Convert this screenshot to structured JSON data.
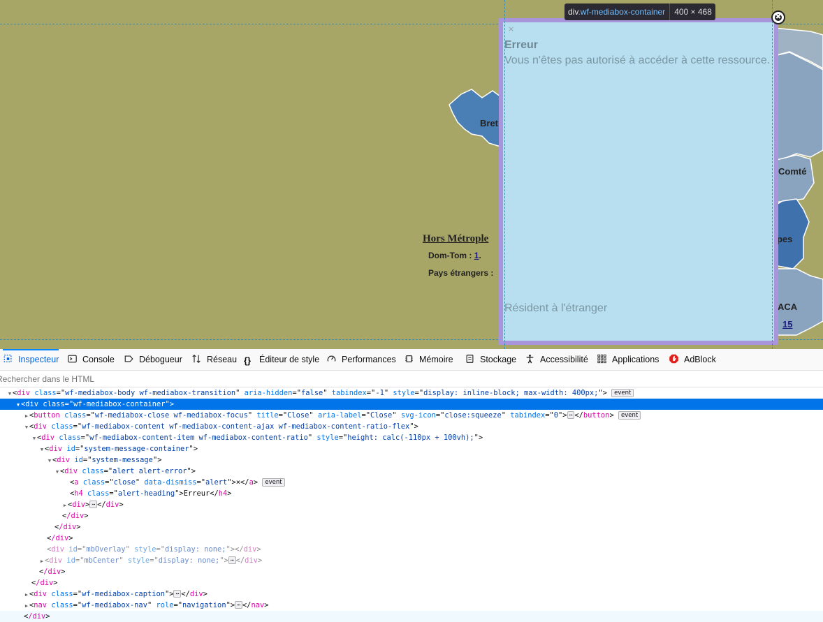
{
  "map": {
    "labels": {
      "bretagne": "Bret",
      "franche_comte": "Comté",
      "alpes": "pes",
      "paca": "ACA"
    },
    "hors_metropole": "Hors Métrople",
    "dom_tom_label": "Dom-Tom :",
    "dom_tom_value": "1",
    "dom_tom_suffix": ".",
    "pays_label": "Pays étrangers :",
    "paca_value": "15"
  },
  "mediabox": {
    "close_glyph": "×",
    "heading": "Erreur",
    "message": "Vous n'êtes pas autorisé à accéder à cette ressource.",
    "caption": "Résident à l'étranger",
    "close_icon_glyph": "✖"
  },
  "tooltip": {
    "tag": "div",
    "class": ".wf-mediabox-container",
    "dimensions": "400 × 468"
  },
  "devtools": {
    "tabs": [
      {
        "label": "Inspecteur",
        "icon": "inspector-icon",
        "active": true
      },
      {
        "label": "Console",
        "icon": "console-icon"
      },
      {
        "label": "Débogueur",
        "icon": "debugger-icon"
      },
      {
        "label": "Réseau",
        "icon": "network-icon"
      },
      {
        "label": "Éditeur de style",
        "icon": "style-editor-icon"
      },
      {
        "label": "Performances",
        "icon": "performance-icon"
      },
      {
        "label": "Mémoire",
        "icon": "memory-icon"
      },
      {
        "label": "Stockage",
        "icon": "storage-icon"
      },
      {
        "label": "Accessibilité",
        "icon": "accessibility-icon"
      },
      {
        "label": "Applications",
        "icon": "applications-icon"
      },
      {
        "label": "AdBlock",
        "icon": "adblock-icon"
      }
    ],
    "search_placeholder": "Rechercher dans le HTML",
    "event_badge": "event",
    "ellipsis": "⋯"
  },
  "dom": {
    "n0": {
      "tag": "div",
      "class": "wf-mediabox-body wf-mediabox-transition",
      "aria_hidden": "false",
      "tabindex": "-1",
      "style": "display: inline-block; max-width: 400px;"
    },
    "n1": {
      "tag": "div",
      "class": "wf-mediabox-container"
    },
    "n2": {
      "tag": "button",
      "class": "wf-mediabox-close wf-mediabox-focus",
      "title": "Close",
      "aria_label": "Close",
      "svg_icon": "close:squeeze",
      "tabindex": "0"
    },
    "n3": {
      "tag": "div",
      "class": "wf-mediabox-content wf-mediabox-content-ajax wf-mediabox-content-ratio-flex"
    },
    "n4": {
      "tag": "div",
      "class": "wf-mediabox-content-item wf-mediabox-content-ratio",
      "style": "height: calc(-110px + 100vh);"
    },
    "n5": {
      "tag": "div",
      "id": "system-message-container"
    },
    "n6": {
      "tag": "div",
      "id": "system-message"
    },
    "n7": {
      "tag": "div",
      "class": "alert alert-error"
    },
    "n8": {
      "tag": "a",
      "class": "close",
      "data_dismiss": "alert",
      "text": "×"
    },
    "n9": {
      "tag": "h4",
      "class": "alert-heading",
      "text": "Erreur"
    },
    "n10": {
      "tag": "div"
    },
    "n11": {
      "close": "/div"
    },
    "n12": {
      "close": "/div"
    },
    "n13": {
      "close": "/div"
    },
    "n14": {
      "tag": "div",
      "id": "mbOverlay",
      "style": "display: none;"
    },
    "n15": {
      "tag": "div",
      "id": "mbCenter",
      "style": "display: none;"
    },
    "n16": {
      "close": "/div"
    },
    "n17": {
      "close": "/div"
    },
    "n18": {
      "tag": "div",
      "class": "wf-mediabox-caption"
    },
    "n19": {
      "tag": "nav",
      "class": "wf-mediabox-nav",
      "role": "navigation"
    },
    "n20": {
      "close": "/div"
    }
  }
}
